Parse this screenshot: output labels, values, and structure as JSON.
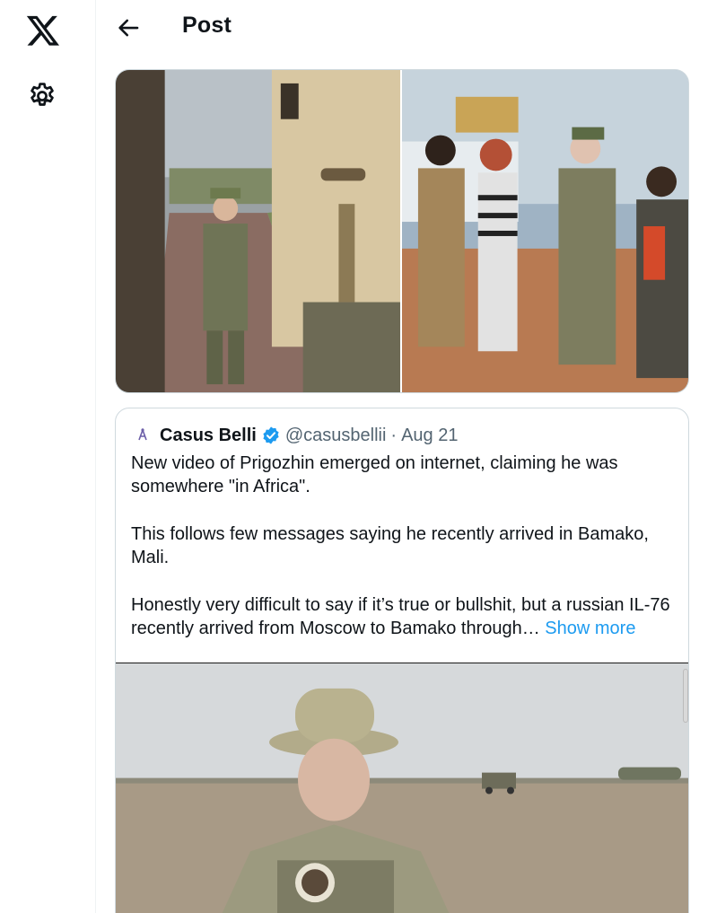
{
  "nav": {
    "logo_icon": "x-logo-icon",
    "settings_icon": "gear-icon"
  },
  "header": {
    "back_icon": "arrow-left-icon",
    "title": "Post"
  },
  "media": {
    "images": [
      {
        "name": "photo-soldier-by-vehicle-door"
      },
      {
        "name": "photo-group-of-men"
      }
    ]
  },
  "quote": {
    "author_name": "Casus Belli",
    "verified_icon": "verified-badge-icon",
    "handle": "@casusbellii",
    "separator": "·",
    "date": "Aug 21",
    "paragraphs": [
      "New video of Prigozhin emerged on internet, claiming he was somewhere \"in Africa\".",
      "This follows few messages saying he recently arrived in Bamako, Mali.",
      "Honestly very difficult to say if it’s true or bullshit, but a russian IL-76 recently arrived from Moscow to Bamako through…"
    ],
    "show_more": "Show more",
    "video": {
      "name": "video-thumbnail"
    }
  },
  "colors": {
    "text": "#0f1419",
    "secondary": "#536471",
    "link": "#1d9bf0",
    "border": "#cfd9de"
  }
}
